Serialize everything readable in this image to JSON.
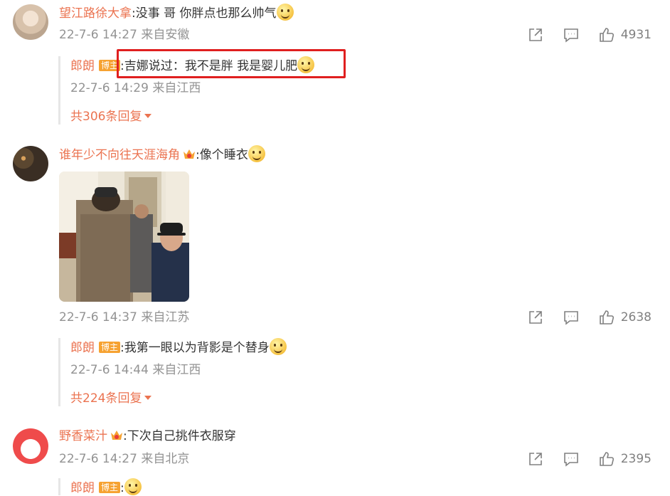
{
  "comments": [
    {
      "user": "望江路徐大拿",
      "text": ":没事 哥 你胖点也那么帅气",
      "emoji": "grin-emoji",
      "date": "22-7-6 14:27",
      "location": "来自安徽",
      "likes": "4931",
      "reply": {
        "user": "郎朗",
        "badge": "博主",
        "text": ":吉娜说过：我不是胖 我是婴儿肥",
        "emoji": "glasses-emoji",
        "date": "22-7-6 14:29",
        "location": "来自江西"
      },
      "more": "共306条回复"
    },
    {
      "user": "谁年少不向往天涯海角",
      "text": ":像个睡衣",
      "emoji": "dog-emoji",
      "date": "22-7-6 14:37",
      "location": "来自江苏",
      "likes": "2638",
      "reply": {
        "user": "郎朗",
        "badge": "博主",
        "text": ":我第一眼以为背影是个替身",
        "emoji": "thinking-emoji",
        "date": "22-7-6 14:44",
        "location": "来自江西"
      },
      "more": "共224条回复"
    },
    {
      "user": "野香菜汁",
      "text": ":下次自己挑件衣服穿",
      "date": "22-7-6 14:27",
      "location": "来自北京",
      "likes": "2395",
      "reply": {
        "user": "郎朗",
        "badge": "博主",
        "text": ":",
        "emoji": "thinking-emoji"
      }
    }
  ],
  "colors": {
    "username": "#eb7350",
    "meta": "#939393",
    "badge": "#f6a231",
    "highlight": "#e01f1f"
  }
}
